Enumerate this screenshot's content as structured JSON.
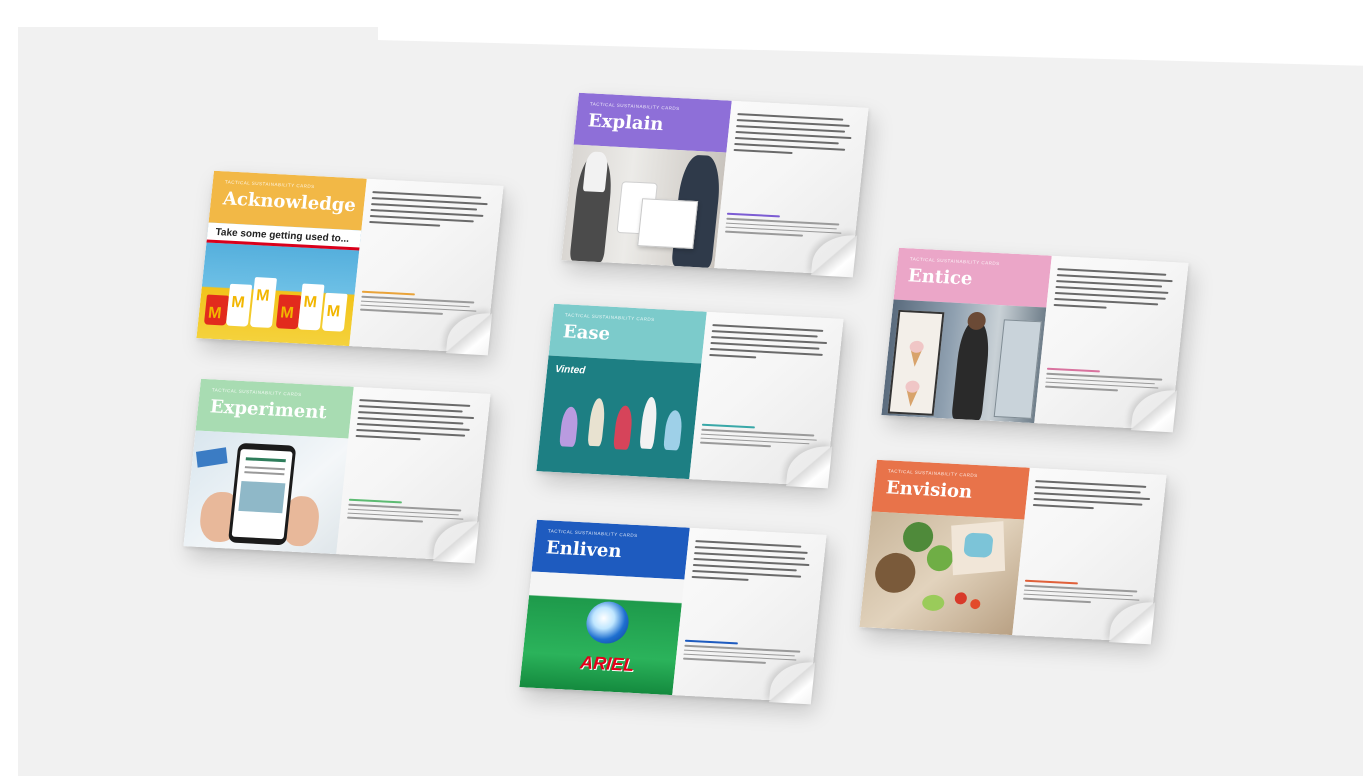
{
  "cards": [
    {
      "id": "acknowledge",
      "kicker": "TACTICAL SUSTAINABILITY CARDS",
      "title": "Acknowledge",
      "band_color": "#f2b846",
      "accent": "#e9a33a",
      "photo_caption": "Take some getting used to..."
    },
    {
      "id": "explain",
      "kicker": "TACTICAL SUSTAINABILITY CARDS",
      "title": "Explain",
      "band_color": "#8e6fd8",
      "accent": "#7c5cd3"
    },
    {
      "id": "ease",
      "kicker": "TACTICAL SUSTAINABILITY CARDS",
      "title": "Ease",
      "band_color": "#7ccbcb",
      "accent": "#39a8a8",
      "photo_caption": "Vinted"
    },
    {
      "id": "entice",
      "kicker": "TACTICAL SUSTAINABILITY CARDS",
      "title": "Entice",
      "band_color": "#eba6c8",
      "accent": "#d9739f"
    },
    {
      "id": "experiment",
      "kicker": "TACTICAL SUSTAINABILITY CARDS",
      "title": "Experiment",
      "band_color": "#a8dcb2",
      "accent": "#5dbb72"
    },
    {
      "id": "enliven",
      "kicker": "TACTICAL SUSTAINABILITY CARDS",
      "title": "Enliven",
      "band_color": "#1e5bbf",
      "accent": "#1e5bbf",
      "photo_caption": "ARIEL"
    },
    {
      "id": "envision",
      "kicker": "TACTICAL SUSTAINABILITY CARDS",
      "title": "Envision",
      "band_color": "#e8734a",
      "accent": "#e0603a"
    }
  ]
}
